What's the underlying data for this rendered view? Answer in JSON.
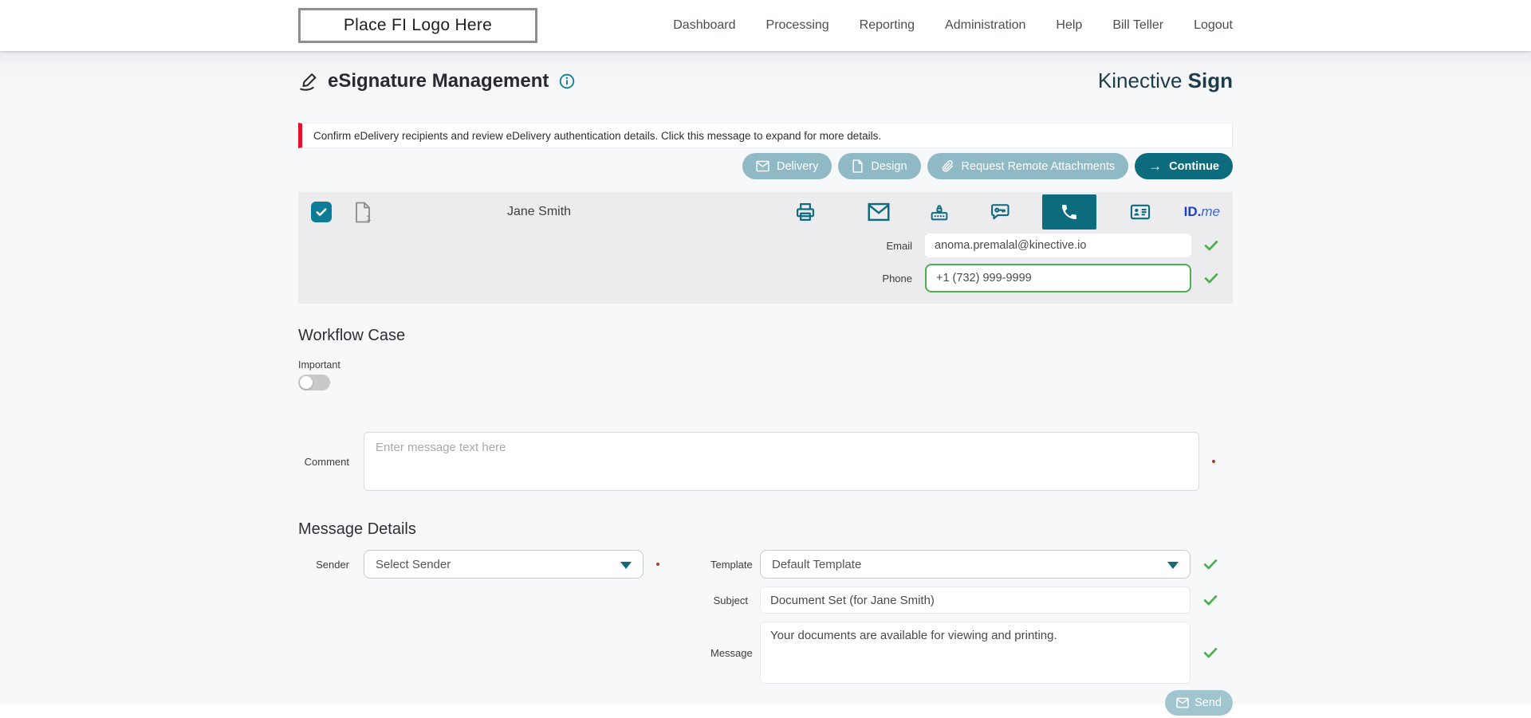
{
  "header": {
    "logo_text": "Place FI Logo Here",
    "nav": [
      {
        "label": "Dashboard"
      },
      {
        "label": "Processing"
      },
      {
        "label": "Reporting"
      },
      {
        "label": "Administration"
      },
      {
        "label": "Help"
      },
      {
        "label": "Bill Teller"
      },
      {
        "label": "Logout"
      }
    ]
  },
  "page": {
    "title": "eSignature Management",
    "brand_name": "Kinective ",
    "brand_product": "Sign",
    "alert_text": "Confirm eDelivery recipients and review eDelivery authentication details. Click this message to expand for more details.",
    "actions": {
      "delivery": "Delivery",
      "design": "Design",
      "request_remote_attachments": "Request Remote Attachments",
      "continue": "Continue"
    }
  },
  "recipient": {
    "name": "Jane Smith",
    "document_count": "1",
    "email_label": "Email",
    "email_value": "anoma.premalal@kinective.io",
    "phone_label": "Phone",
    "phone_value": "+1 (732) 999-9999",
    "idme_prefix": "ID.",
    "idme_suffix": "me"
  },
  "workflow_case": {
    "heading": "Workflow Case",
    "important_label": "Important",
    "important_enabled": false,
    "comment_label": "Comment",
    "comment_placeholder": "Enter message text here"
  },
  "message_details": {
    "heading": "Message Details",
    "sender_label": "Sender",
    "sender_value": "Select Sender",
    "template_label": "Template",
    "template_value": "Default Template",
    "subject_label": "Subject",
    "subject_value": "Document Set (for Jane Smith)",
    "message_label": "Message",
    "message_value": "Your documents are available for viewing and printing.",
    "send_label": "Send"
  },
  "icons": {
    "arrow_right": "→"
  },
  "colors": {
    "accent_teal": "#0d6b7e",
    "accent_teal_light": "#8fb9c4",
    "send_disabled": "#a0c5ce",
    "checkbox_teal": "#0e7c96",
    "success_green": "#4caf50",
    "alert_red": "#e8112d",
    "brand_navy": "#1d3c4b",
    "idme_blue": "#1d3fc4",
    "required_dot": "#b23a2e"
  }
}
